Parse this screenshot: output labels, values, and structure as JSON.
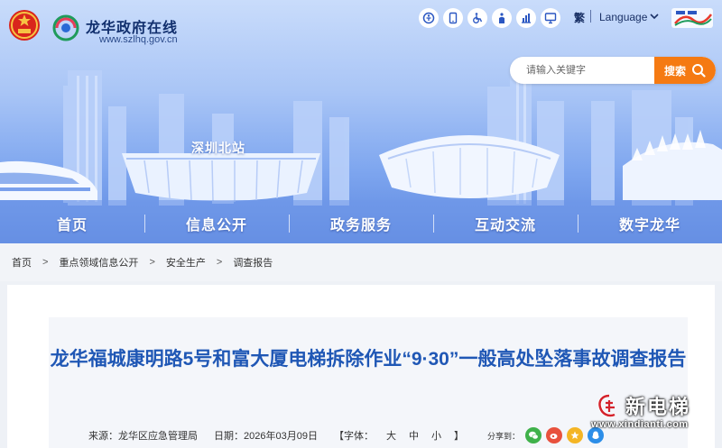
{
  "header": {
    "site_title": "龙华政府在线",
    "site_domain": "www.szlhq.gov.cn",
    "lang_fan": "繁",
    "language_label": "Language",
    "tool_icons": [
      "accessibility-icon",
      "mobile-icon",
      "wheelchair-icon",
      "elder-icon",
      "chart-icon",
      "monitor-icon"
    ]
  },
  "search": {
    "placeholder": "请输入关键字",
    "button_label": "搜索"
  },
  "banner": {
    "station_label": "深圳北站"
  },
  "nav": {
    "items": [
      {
        "label": "首页"
      },
      {
        "label": "信息公开"
      },
      {
        "label": "政务服务"
      },
      {
        "label": "互动交流"
      },
      {
        "label": "数字龙华"
      }
    ]
  },
  "breadcrumb": {
    "items": [
      {
        "label": "首页"
      },
      {
        "label": "重点领域信息公开"
      },
      {
        "label": "安全生产"
      },
      {
        "label": "调查报告"
      }
    ],
    "separator": ">"
  },
  "article": {
    "title": "龙华福城康明路5号和富大厦电梯拆除作业“9·30”一般高处坠落事故调查报告",
    "source": "来源：龙华区应急管理局",
    "date": "日期：2026年03月09日",
    "font_bracket_open": "【",
    "font_label": "字体：",
    "font_large": "大",
    "font_medium": "中",
    "font_small": "小",
    "font_bracket_close": "】",
    "share_label": "分享到："
  },
  "watermark": {
    "text": "新电梯",
    "url": "www.xindianti.com"
  },
  "colors": {
    "accent": "#f57a12",
    "title_blue": "#1f57b5",
    "nav_text": "#ffffff"
  }
}
